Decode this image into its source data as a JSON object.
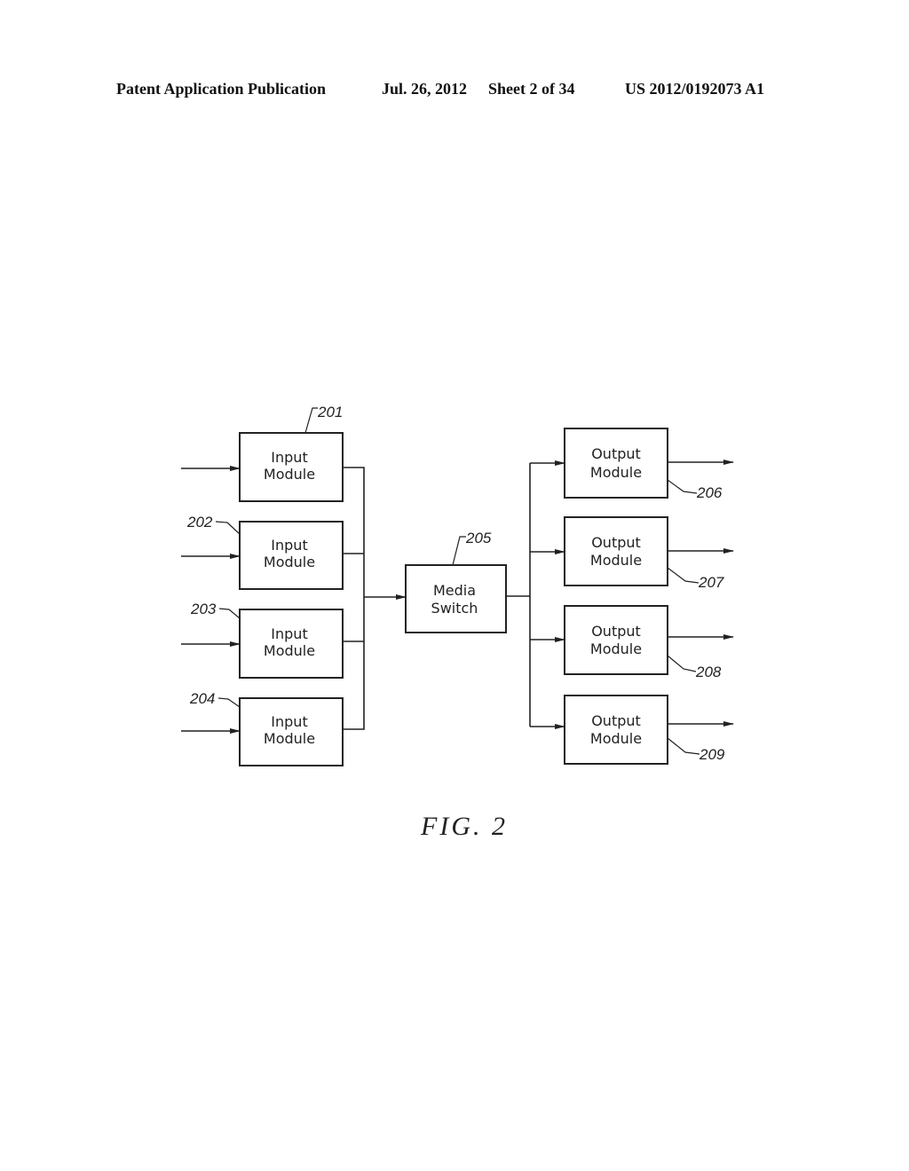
{
  "header": {
    "publication": "Patent Application Publication",
    "date": "Jul. 26, 2012",
    "sheet": "Sheet 2 of 34",
    "number": "US 2012/0192073 A1"
  },
  "figure": {
    "label": "FIG. 2",
    "inputs": [
      {
        "ref": "201",
        "line1": "Input",
        "line2": "Module"
      },
      {
        "ref": "202",
        "line1": "Input",
        "line2": "Module"
      },
      {
        "ref": "203",
        "line1": "Input",
        "line2": "Module"
      },
      {
        "ref": "204",
        "line1": "Input",
        "line2": "Module"
      }
    ],
    "switch": {
      "ref": "205",
      "line1": "Media",
      "line2": "Switch"
    },
    "outputs": [
      {
        "ref": "206",
        "line1": "Output",
        "line2": "Module"
      },
      {
        "ref": "207",
        "line1": "Output",
        "line2": "Module"
      },
      {
        "ref": "208",
        "line1": "Output",
        "line2": "Module"
      },
      {
        "ref": "209",
        "line1": "Output",
        "line2": "Module"
      }
    ]
  }
}
